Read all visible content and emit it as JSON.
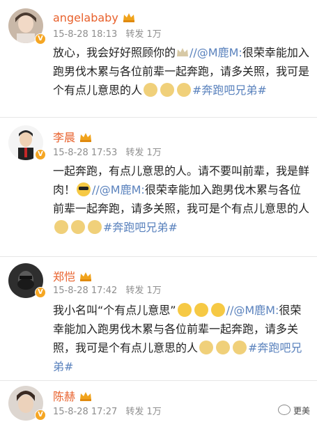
{
  "posts": [
    {
      "name": "angelababy",
      "time": "15-8-28 18:13",
      "repost": "转发 1万",
      "body": {
        "t1": "放心，我会好好照顾你的",
        "mention": "//@M鹿M:",
        "t2": "很荣幸能加入跑男伐木累与各位前辈一起奔跑，请多关照，我可是个有点儿意思的人",
        "hashtag": "#奔跑吧兄弟#"
      }
    },
    {
      "name": "李晨",
      "time": "15-8-28 17:53",
      "repost": "转发 1万",
      "body": {
        "t1": "一起奔跑，有点儿意思的人。请不要叫前辈，我是鲜肉！",
        "mention": "//@M鹿M:",
        "t2": "很荣幸能加入跑男伐木累与各位前辈一起奔跑，请多关照，我可是个有点儿意思的人",
        "hashtag": "#奔跑吧兄弟#"
      }
    },
    {
      "name": "郑恺",
      "time": "15-8-28 17:42",
      "repost": "转发 1万",
      "body": {
        "t1": "我小名叫“个有点儿意思”",
        "mention": "//@M鹿M:",
        "t2": "很荣幸能加入跑男伐木累与各位前辈一起奔跑，请多关照，我可是个有点儿意思的人",
        "hashtag": "#奔跑吧兄弟#"
      }
    },
    {
      "name": "陈赫",
      "time": "15-8-28 17:27",
      "repost": "转发 1万"
    }
  ],
  "watermark": "更美",
  "colors": {
    "name": "#e8612c",
    "link": "#5a82bd",
    "meta": "#8e8e8e",
    "badge": "#f5a623"
  }
}
